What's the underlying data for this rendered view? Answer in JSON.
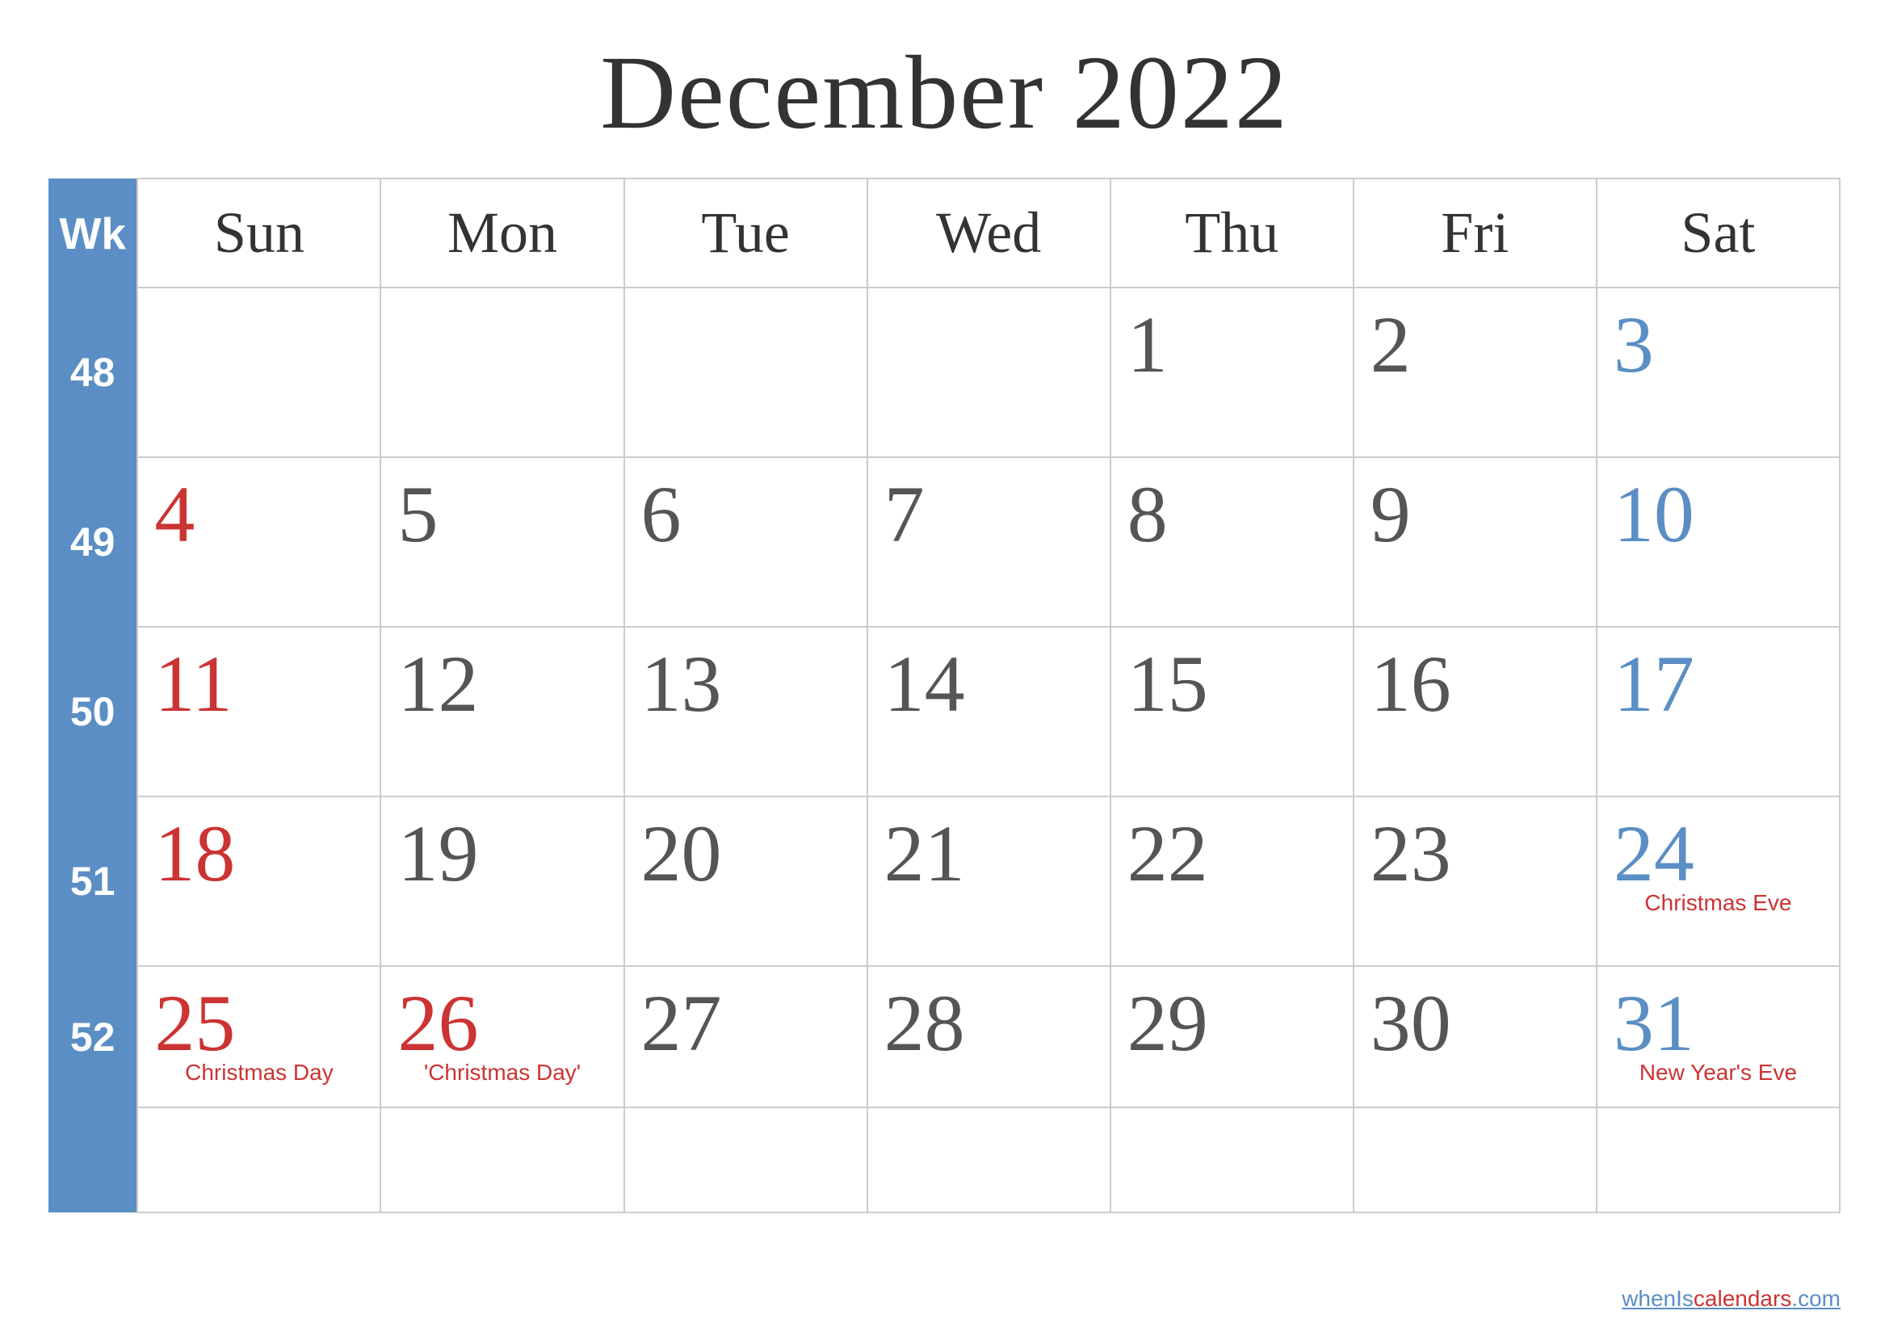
{
  "title": "December 2022",
  "header": {
    "wk_label": "Wk",
    "days": [
      "Sun",
      "Mon",
      "Tue",
      "Wed",
      "Thu",
      "Fri",
      "Sat"
    ]
  },
  "weeks": [
    {
      "wk": "48",
      "days": [
        {
          "date": "",
          "type": "empty"
        },
        {
          "date": "",
          "type": "empty"
        },
        {
          "date": "",
          "type": "empty"
        },
        {
          "date": "",
          "type": "empty"
        },
        {
          "date": "1",
          "type": "regular"
        },
        {
          "date": "2",
          "type": "regular"
        },
        {
          "date": "3",
          "type": "saturday"
        }
      ]
    },
    {
      "wk": "49",
      "days": [
        {
          "date": "4",
          "type": "sunday"
        },
        {
          "date": "5",
          "type": "regular"
        },
        {
          "date": "6",
          "type": "regular"
        },
        {
          "date": "7",
          "type": "regular"
        },
        {
          "date": "8",
          "type": "regular"
        },
        {
          "date": "9",
          "type": "regular"
        },
        {
          "date": "10",
          "type": "saturday"
        }
      ]
    },
    {
      "wk": "50",
      "days": [
        {
          "date": "11",
          "type": "sunday"
        },
        {
          "date": "12",
          "type": "regular"
        },
        {
          "date": "13",
          "type": "regular"
        },
        {
          "date": "14",
          "type": "regular"
        },
        {
          "date": "15",
          "type": "regular"
        },
        {
          "date": "16",
          "type": "regular"
        },
        {
          "date": "17",
          "type": "saturday"
        }
      ]
    },
    {
      "wk": "51",
      "days": [
        {
          "date": "18",
          "type": "sunday"
        },
        {
          "date": "19",
          "type": "regular"
        },
        {
          "date": "20",
          "type": "regular"
        },
        {
          "date": "21",
          "type": "regular"
        },
        {
          "date": "22",
          "type": "regular"
        },
        {
          "date": "23",
          "type": "regular"
        },
        {
          "date": "24",
          "type": "saturday",
          "holiday": "Christmas Eve"
        }
      ]
    },
    {
      "wk": "52",
      "days": [
        {
          "date": "25",
          "type": "sunday",
          "holiday": "Christmas Day"
        },
        {
          "date": "26",
          "type": "holiday",
          "holiday": "'Christmas Day'"
        },
        {
          "date": "27",
          "type": "regular"
        },
        {
          "date": "28",
          "type": "regular"
        },
        {
          "date": "29",
          "type": "regular"
        },
        {
          "date": "30",
          "type": "regular"
        },
        {
          "date": "31",
          "type": "saturday",
          "holiday": "New Year's Eve"
        }
      ]
    }
  ],
  "watermark": "wheniscalendars.com",
  "colors": {
    "blue": "#5b8ec4",
    "red": "#cc3333",
    "gray": "#555555"
  }
}
